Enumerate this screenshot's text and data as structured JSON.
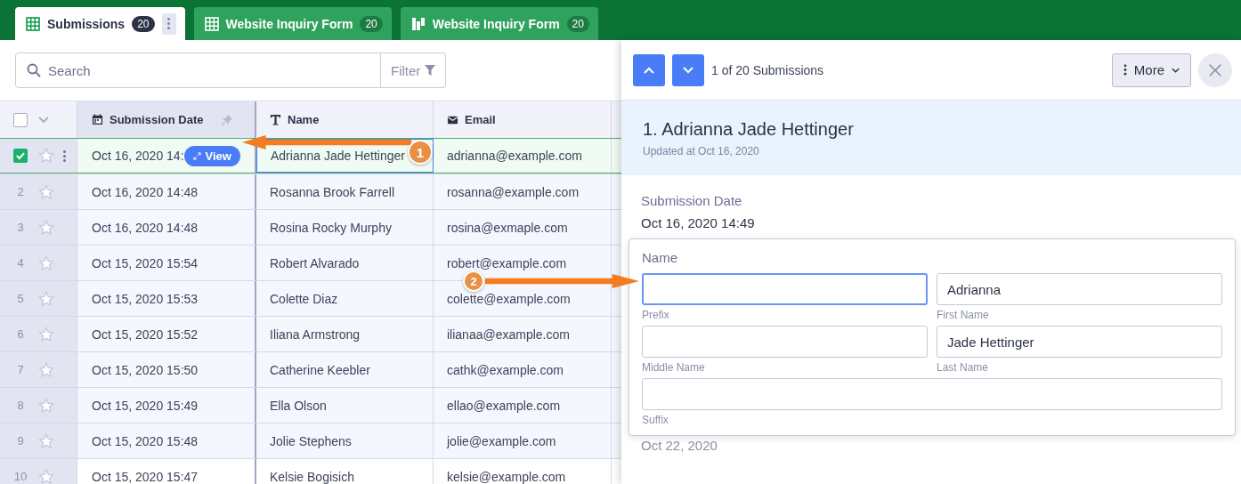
{
  "tabs": [
    {
      "label": "Submissions",
      "count": "20",
      "kind": "table",
      "selected": true
    },
    {
      "label": "Website Inquiry Form",
      "count": "20",
      "kind": "table",
      "selected": false
    },
    {
      "label": "Website Inquiry Form",
      "count": "20",
      "kind": "report",
      "selected": false
    }
  ],
  "search": {
    "placeholder": "Search"
  },
  "filter_button": "Filter",
  "table": {
    "select_all": {
      "checked": false
    },
    "columns": [
      {
        "label": "Submission Date",
        "kind": "date",
        "pinned": true
      },
      {
        "label": "Name",
        "kind": "text",
        "pinned": false
      },
      {
        "label": "Email",
        "kind": "email",
        "pinned": false
      }
    ],
    "rows": [
      {
        "date": "Oct 16, 2020 14:",
        "name": "Adrianna Jade Hettinger",
        "email": "adrianna@example.com",
        "checked": true,
        "starred": false,
        "selected": true,
        "view_button": "View"
      },
      {
        "number": "2",
        "date": "Oct 16, 2020 14:48",
        "name": "Rosanna Brook Farrell",
        "email": "rosanna@example.com",
        "checked": false,
        "starred": false,
        "selected": false
      },
      {
        "number": "3",
        "date": "Oct 16, 2020 14:48",
        "name": "Rosina Rocky Murphy",
        "email": "rosina@exmaple.com",
        "checked": false,
        "starred": false,
        "selected": false
      },
      {
        "number": "4",
        "date": "Oct 15, 2020 15:54",
        "name": "Robert Alvarado",
        "email": "robert@example.com",
        "checked": false,
        "starred": false,
        "selected": false
      },
      {
        "number": "5",
        "date": "Oct 15, 2020 15:53",
        "name": "Colette Diaz",
        "email": "colette@example.com",
        "checked": false,
        "starred": false,
        "selected": false
      },
      {
        "number": "6",
        "date": "Oct 15, 2020 15:52",
        "name": "Iliana Armstrong",
        "email": "ilianaa@example.com",
        "checked": false,
        "starred": false,
        "selected": false
      },
      {
        "number": "7",
        "date": "Oct 15, 2020 15:50",
        "name": "Catherine Keebler",
        "email": "cathk@example.com",
        "checked": false,
        "starred": false,
        "selected": false
      },
      {
        "number": "8",
        "date": "Oct 15, 2020 15:49",
        "name": "Ella Olson",
        "email": "ellao@example.com",
        "checked": false,
        "starred": false,
        "selected": false
      },
      {
        "number": "9",
        "date": "Oct 15, 2020 15:48",
        "name": "Jolie Stephens",
        "email": "jolie@example.com",
        "checked": false,
        "starred": false,
        "selected": false
      },
      {
        "number": "10",
        "date": "Oct 15, 2020 15:47",
        "name": "Kelsie Bogisich",
        "email": "kelsie@example.com",
        "checked": false,
        "starred": false,
        "selected": false
      }
    ]
  },
  "panel": {
    "position": "1 of 20 Submissions",
    "more_button": "More",
    "title": "1. Adrianna Jade Hettinger",
    "updated": "Updated at Oct 16, 2020",
    "date_field": {
      "label": "Submission Date",
      "value": "Oct 16, 2020 14:49"
    },
    "name_card": {
      "label": "Name",
      "fields": [
        {
          "caption": "Prefix",
          "focused": true,
          "wide": false
        },
        {
          "caption": "First Name",
          "value": "Adrianna",
          "focused": false,
          "wide": false
        },
        {
          "caption": "Middle Name",
          "focused": false,
          "wide": false
        },
        {
          "caption": "Last Name",
          "value": "Jade Hettinger",
          "focused": false,
          "wide": false
        },
        {
          "caption": "Suffix",
          "focused": false,
          "wide": true
        }
      ]
    },
    "next_value": "Oct 22, 2020"
  },
  "annotations": [
    {
      "label": "1"
    },
    {
      "label": "2"
    }
  ]
}
